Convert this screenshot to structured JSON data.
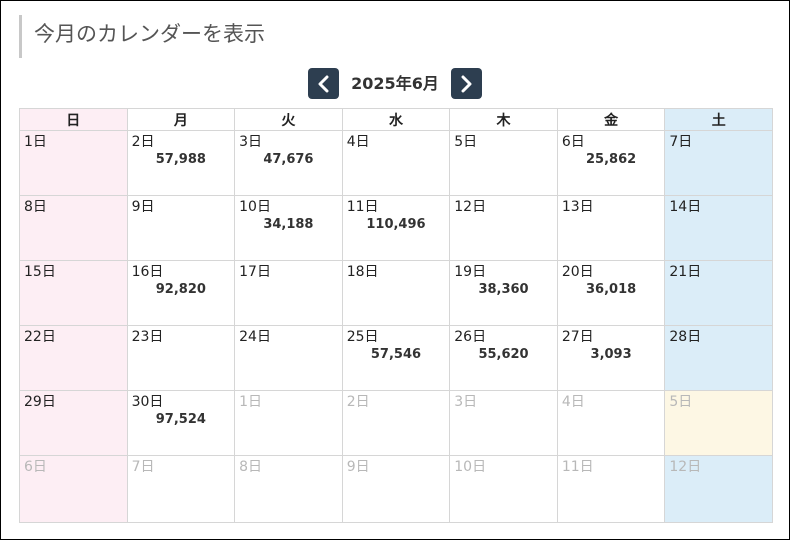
{
  "page_title": "今月のカレンダーを表示",
  "calendar": {
    "month_label": "2025年6月",
    "prev_icon": "chevron-left-icon",
    "next_icon": "chevron-right-icon",
    "weekdays": [
      "日",
      "月",
      "火",
      "水",
      "木",
      "金",
      "土"
    ],
    "colors": {
      "sunday_bg": "#fdeef4",
      "saturday_bg": "#dbedf8",
      "nav_button": "#2d3e50",
      "highlight_bg": "#fdf7e4"
    },
    "weeks": [
      [
        {
          "day": "1日",
          "value": "",
          "other": false
        },
        {
          "day": "2日",
          "value": "57,988",
          "other": false
        },
        {
          "day": "3日",
          "value": "47,676",
          "other": false
        },
        {
          "day": "4日",
          "value": "",
          "other": false
        },
        {
          "day": "5日",
          "value": "",
          "other": false
        },
        {
          "day": "6日",
          "value": "25,862",
          "other": false
        },
        {
          "day": "7日",
          "value": "",
          "other": false
        }
      ],
      [
        {
          "day": "8日",
          "value": "",
          "other": false
        },
        {
          "day": "9日",
          "value": "",
          "other": false
        },
        {
          "day": "10日",
          "value": "34,188",
          "other": false
        },
        {
          "day": "11日",
          "value": "110,496",
          "other": false
        },
        {
          "day": "12日",
          "value": "",
          "other": false
        },
        {
          "day": "13日",
          "value": "",
          "other": false
        },
        {
          "day": "14日",
          "value": "",
          "other": false
        }
      ],
      [
        {
          "day": "15日",
          "value": "",
          "other": false
        },
        {
          "day": "16日",
          "value": "92,820",
          "other": false
        },
        {
          "day": "17日",
          "value": "",
          "other": false
        },
        {
          "day": "18日",
          "value": "",
          "other": false
        },
        {
          "day": "19日",
          "value": "38,360",
          "other": false
        },
        {
          "day": "20日",
          "value": "36,018",
          "other": false
        },
        {
          "day": "21日",
          "value": "",
          "other": false
        }
      ],
      [
        {
          "day": "22日",
          "value": "",
          "other": false
        },
        {
          "day": "23日",
          "value": "",
          "other": false
        },
        {
          "day": "24日",
          "value": "",
          "other": false
        },
        {
          "day": "25日",
          "value": "57,546",
          "other": false
        },
        {
          "day": "26日",
          "value": "55,620",
          "other": false
        },
        {
          "day": "27日",
          "value": "3,093",
          "other": false
        },
        {
          "day": "28日",
          "value": "",
          "other": false
        }
      ],
      [
        {
          "day": "29日",
          "value": "",
          "other": false
        },
        {
          "day": "30日",
          "value": "97,524",
          "other": false
        },
        {
          "day": "1日",
          "value": "",
          "other": true
        },
        {
          "day": "2日",
          "value": "",
          "other": true
        },
        {
          "day": "3日",
          "value": "",
          "other": true
        },
        {
          "day": "4日",
          "value": "",
          "other": true
        },
        {
          "day": "5日",
          "value": "",
          "other": true,
          "highlight": true
        }
      ],
      [
        {
          "day": "6日",
          "value": "",
          "other": true
        },
        {
          "day": "7日",
          "value": "",
          "other": true
        },
        {
          "day": "8日",
          "value": "",
          "other": true
        },
        {
          "day": "9日",
          "value": "",
          "other": true
        },
        {
          "day": "10日",
          "value": "",
          "other": true
        },
        {
          "day": "11日",
          "value": "",
          "other": true
        },
        {
          "day": "12日",
          "value": "",
          "other": true
        }
      ]
    ]
  }
}
